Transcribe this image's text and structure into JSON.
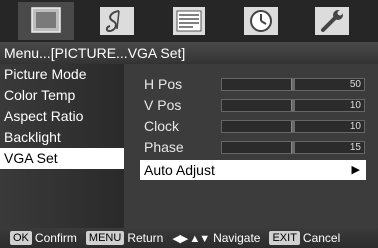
{
  "breadcrumb": "Menu...[PICTURE...VGA Set]",
  "tabs": [
    {
      "icon": "picture-icon",
      "active": true
    },
    {
      "icon": "audio-note-icon",
      "active": false
    },
    {
      "icon": "function-list-icon",
      "active": false
    },
    {
      "icon": "clock-icon",
      "active": false
    },
    {
      "icon": "wrench-icon",
      "active": false
    }
  ],
  "left_menu": {
    "items": [
      {
        "label": "Picture Mode"
      },
      {
        "label": "Color Temp"
      },
      {
        "label": "Aspect Ratio"
      },
      {
        "label": "Backlight"
      },
      {
        "label": "VGA Set",
        "selected": true
      }
    ]
  },
  "vga_settings": {
    "rows": [
      {
        "label": "H Pos",
        "value": "50",
        "level": 0.5
      },
      {
        "label": "V Pos",
        "value": "10",
        "level": 0.5
      },
      {
        "label": "Clock",
        "value": "10",
        "level": 0.5
      },
      {
        "label": "Phase",
        "value": "15",
        "level": 0.5
      }
    ],
    "auto_adjust": {
      "label": "Auto Adjust",
      "arrow": "▶"
    }
  },
  "hints": [
    {
      "key": "OK",
      "action": "Confirm"
    },
    {
      "key": "MENU",
      "action": "Return"
    },
    {
      "key": "◀▶ ▲▼",
      "action": "Navigate"
    },
    {
      "key": "EXIT",
      "action": "Cancel"
    }
  ],
  "colors": {
    "selected_bg": "#ffffff",
    "panel_bg": "#3c3c3c",
    "icon_color": "#d8d8d8"
  }
}
